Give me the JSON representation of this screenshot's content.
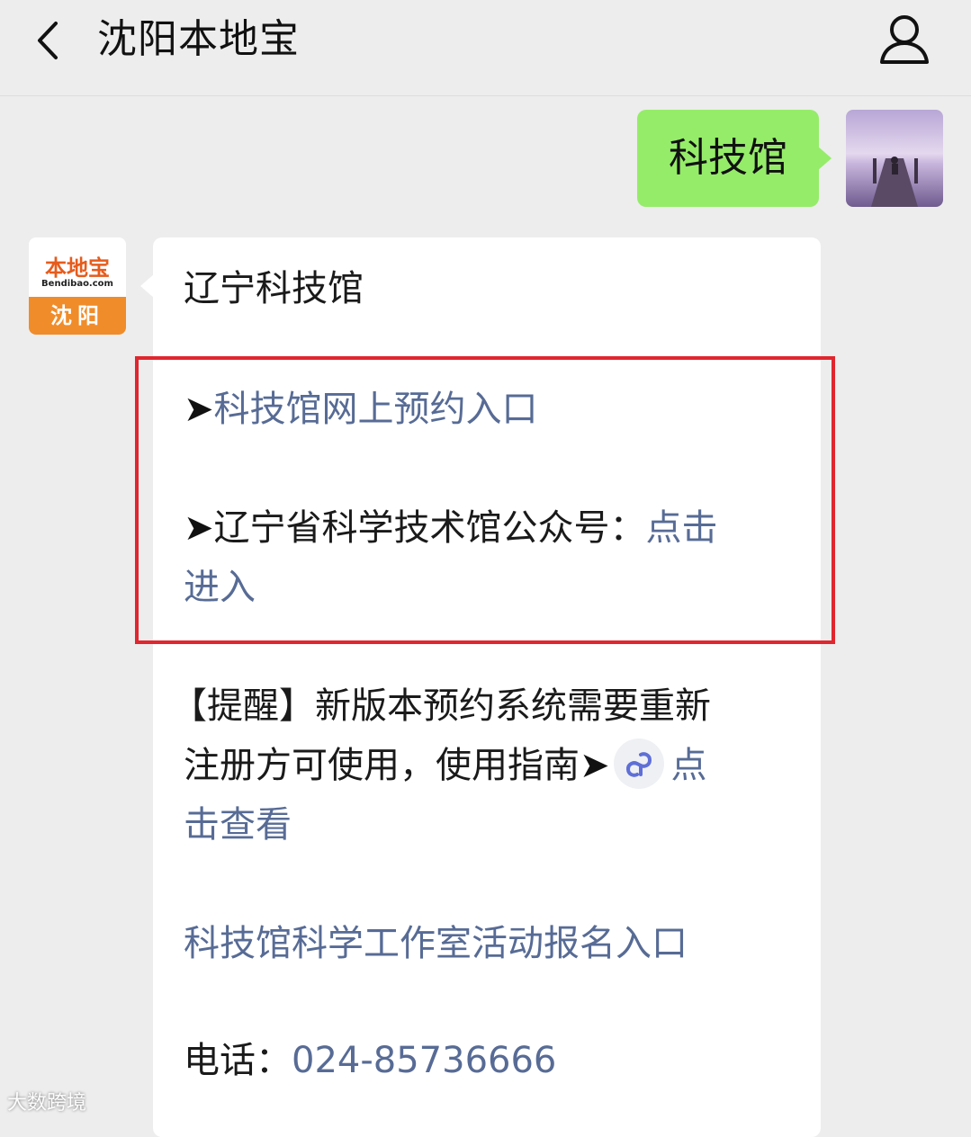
{
  "header": {
    "title": "沈阳本地宝",
    "back_icon": "chevron-left-icon",
    "profile_icon": "person-icon"
  },
  "user_message": {
    "text": "科技馆",
    "bubble_color": "#95ec69"
  },
  "account_avatar": {
    "logo_text": "本地宝",
    "site_text": "Bendibao.com",
    "city_text": "沈阳",
    "accent_color": "#f08c2a"
  },
  "reply": {
    "heading": "辽宁科技馆",
    "arrow_glyph": "➤",
    "item1_link": "科技馆网上预约入口",
    "item2_label": "辽宁省科学技术馆公众号：",
    "item2_link_part1": "点击",
    "item2_link_part2": "进入",
    "reminder_line1": "【提醒】新版本预约系统需要重新",
    "reminder_line2_text": "注册方可使用，使用指南",
    "reminder_link_part1": "点",
    "reminder_link_part2": "击查看",
    "studio_link": "科技馆科学工作室活动报名入口",
    "phone_label": "电话：",
    "phone_number": "024-85736666",
    "link_color": "#576b95",
    "highlight_color": "#e0262e",
    "mini_program_icon": "mini-program-icon"
  },
  "watermark": {
    "text": "大数跨境"
  }
}
